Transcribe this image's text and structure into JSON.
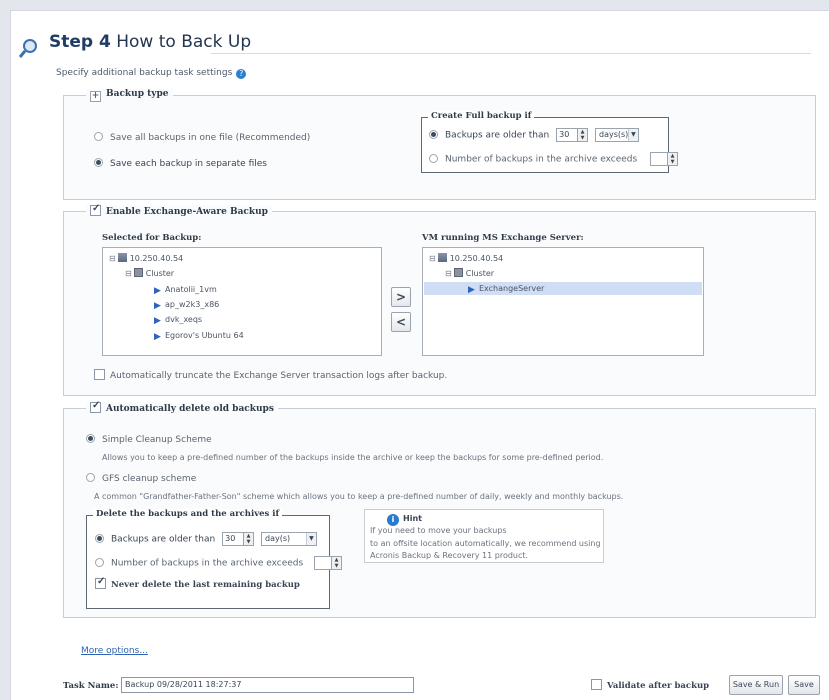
{
  "header": {
    "step": "Step 4",
    "title": "How to Back Up",
    "subtitle": "Specify additional backup task settings"
  },
  "backup_type": {
    "heading": "Backup type",
    "opt_one_file": "Save all backups in one file (Recommended)",
    "opt_separate": "Save each backup in separate files",
    "full_backup": {
      "heading": "Create Full backup if",
      "opt_older": "Backups are older than",
      "older_value": "30",
      "older_unit": "days(s)",
      "opt_number": "Number of backups in the archive exceeds",
      "number_value": ""
    }
  },
  "exchange": {
    "heading": "Enable Exchange-Aware Backup",
    "selected_label": "Selected for Backup:",
    "vm_label": "VM running MS Exchange Server:",
    "left_tree": {
      "host": "10.250.40.54",
      "cluster": "Cluster",
      "vms": [
        "Anatolii_1vm",
        "ap_w2k3_x86",
        "dvk_xeqs",
        "Egorov's Ubuntu 64"
      ]
    },
    "right_tree": {
      "host": "10.250.40.54",
      "cluster": "Cluster",
      "vm": "ExchangeServer"
    },
    "move_right": ">",
    "move_left": "<",
    "truncate_logs": "Automatically truncate the Exchange Server transaction logs after backup."
  },
  "auto_delete": {
    "heading": "Automatically delete old backups",
    "simple_scheme": "Simple Cleanup Scheme",
    "simple_desc": "Allows you to keep a pre-defined number of the backups inside the archive or keep the backups for some pre-defined period.",
    "gfs_scheme": "GFS cleanup scheme",
    "gfs_desc": "A common \"Grandfather-Father-Son\" scheme which allows you to keep a pre-defined number of daily, weekly and monthly backups.",
    "delete_box": {
      "heading": "Delete the backups and the archives if",
      "opt_older": "Backups are older than",
      "older_value": "30",
      "older_unit": "day(s)",
      "opt_number": "Number of backups in the archive exceeds",
      "number_value": "",
      "never_delete": "Never delete the last remaining backup"
    },
    "hint": {
      "title": "Hint",
      "line1": "If you need to move your backups",
      "line2": "to an offsite location automatically, we recommend using",
      "line3": "Acronis Backup & Recovery 11 product."
    }
  },
  "more_options": "More options...",
  "footer": {
    "task_name_label": "Task Name:",
    "task_name_value": "Backup 09/28/2011 18:27:37",
    "validate_label": "Validate after backup",
    "save_run_label": "Save & Run",
    "save_label": "Save"
  }
}
